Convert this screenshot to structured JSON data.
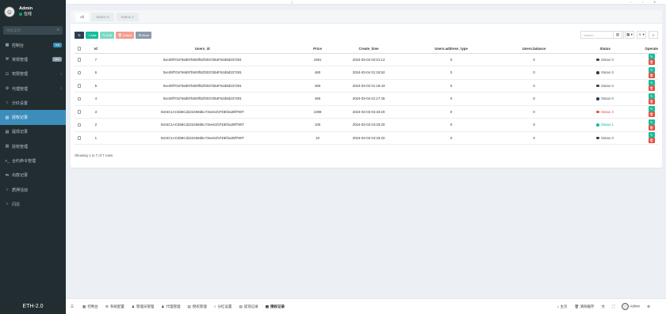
{
  "user": {
    "name": "Admin",
    "status": "在线"
  },
  "search": {
    "placeholder": "搜索菜单"
  },
  "menu": [
    {
      "icon": "▦",
      "label": "控制台",
      "badge": "hot",
      "badge_color": "#3c8dbc"
    },
    {
      "icon": "⚒",
      "label": "常规管理",
      "badge": "new",
      "badge_color": "#8b9aa9"
    },
    {
      "icon": "☷",
      "label": "权限管理",
      "caret": "‹"
    },
    {
      "icon": "⚙",
      "label": "代理管理",
      "caret": "‹"
    },
    {
      "icon": "○",
      "label": "分红设置"
    },
    {
      "icon": "▤",
      "label": "授权记录",
      "active": true
    },
    {
      "icon": "▤",
      "label": "提现记录"
    },
    {
      "icon": "▤",
      "label": "授权管理"
    },
    {
      "icon": ">_",
      "label": "合约命令管理"
    },
    {
      "icon": "⇆",
      "label": "出款记录"
    },
    {
      "icon": "○",
      "label": "质押活动"
    },
    {
      "icon": "○",
      "label": "闪兑"
    }
  ],
  "brand": "ETH-2.0",
  "tabs": [
    "All",
    "Status 0",
    "Status 1"
  ],
  "toolbar": {
    "refresh": "↻",
    "add": "+ Add",
    "edit": "✎ Edit",
    "delete": "🗑 Delete",
    "more": "⚙ More",
    "search_placeholder": "Search",
    "right_buttons": [
      "▥",
      "▦ ▾",
      "⇓ ▾",
      "⌕"
    ]
  },
  "columns": [
    "",
    "Id",
    "Users_id",
    "Price",
    "Create_time",
    "Users.address_type",
    "Users.balance",
    "Status",
    "Operate"
  ],
  "rows": [
    {
      "id": "7",
      "users_id": "0xe39f701F56d97b500f52f3037d54F62d9d237291",
      "price": "1591",
      "time": "2024-03-04 02:01:12",
      "type": "0",
      "balance": "0",
      "status": "Status 0",
      "status_color": "#2c3e50"
    },
    {
      "id": "6",
      "users_id": "0xe39f701F56d97b500f52f3037d54F62d9d237291",
      "price": "460",
      "time": "2024-03-04 01:18:52",
      "type": "0",
      "balance": "0",
      "status": "Status 0",
      "status_color": "#2c3e50"
    },
    {
      "id": "5",
      "users_id": "0xe39f701F56d97b500f52f3037d54F62d9d237291",
      "price": "460",
      "time": "2024-03-04 01:18:43",
      "type": "0",
      "balance": "0",
      "status": "Status 0",
      "status_color": "#2c3e50"
    },
    {
      "id": "4",
      "users_id": "0xe39f701F56d97b500f52f3037d54F62d9d237291",
      "price": "460",
      "time": "2024-03-04 01:17:45",
      "type": "0",
      "balance": "0",
      "status": "Status 0",
      "status_color": "#2c3e50"
    },
    {
      "id": "3",
      "users_id": "0x04C1AC6b8Cd222469d5c73ee61fcFDEf4a39f790T",
      "price": "1099",
      "time": "2024-03-03 04:33:20",
      "type": "0",
      "balance": "0",
      "status": "Status 2",
      "status_color": "#e74c3c"
    },
    {
      "id": "2",
      "users_id": "0x04C1AC6b8Cd222469d5c73ee61fcFDEf4a39f790T",
      "price": "100",
      "time": "2024-03-03 04:33:20",
      "type": "0",
      "balance": "0",
      "status": "Status 1",
      "status_color": "#18bc9c"
    },
    {
      "id": "1",
      "users_id": "0x04C1AC6b8Cd222469d5c73ee61fcFDEf4a39f790T",
      "price": "10",
      "time": "2024-03-03 04:33:20",
      "type": "0",
      "balance": "0",
      "status": "Status 0",
      "status_color": "#2c3e50"
    }
  ],
  "row_info": "Showing 1 to 7 of 7 rows",
  "footer": {
    "items": [
      {
        "icon": "☰",
        "label": ""
      },
      {
        "icon": "▦",
        "label": "控制台"
      },
      {
        "icon": "⚙",
        "label": "系统配置"
      },
      {
        "icon": "♟",
        "label": "管理员管理"
      },
      {
        "icon": "♟",
        "label": "代理管理"
      },
      {
        "icon": "▤",
        "label": "授权管理"
      },
      {
        "icon": "○",
        "label": "分红设置"
      },
      {
        "icon": "▤",
        "label": "提现记录"
      },
      {
        "icon": "▤",
        "label": "授权记录",
        "active": true
      }
    ],
    "right": {
      "home": "⌂ 主页",
      "clear": "🗑 清除缓存",
      "lang": "文",
      "fullscreen": "⛶",
      "user": "Admin",
      "settings": "⚙"
    }
  }
}
